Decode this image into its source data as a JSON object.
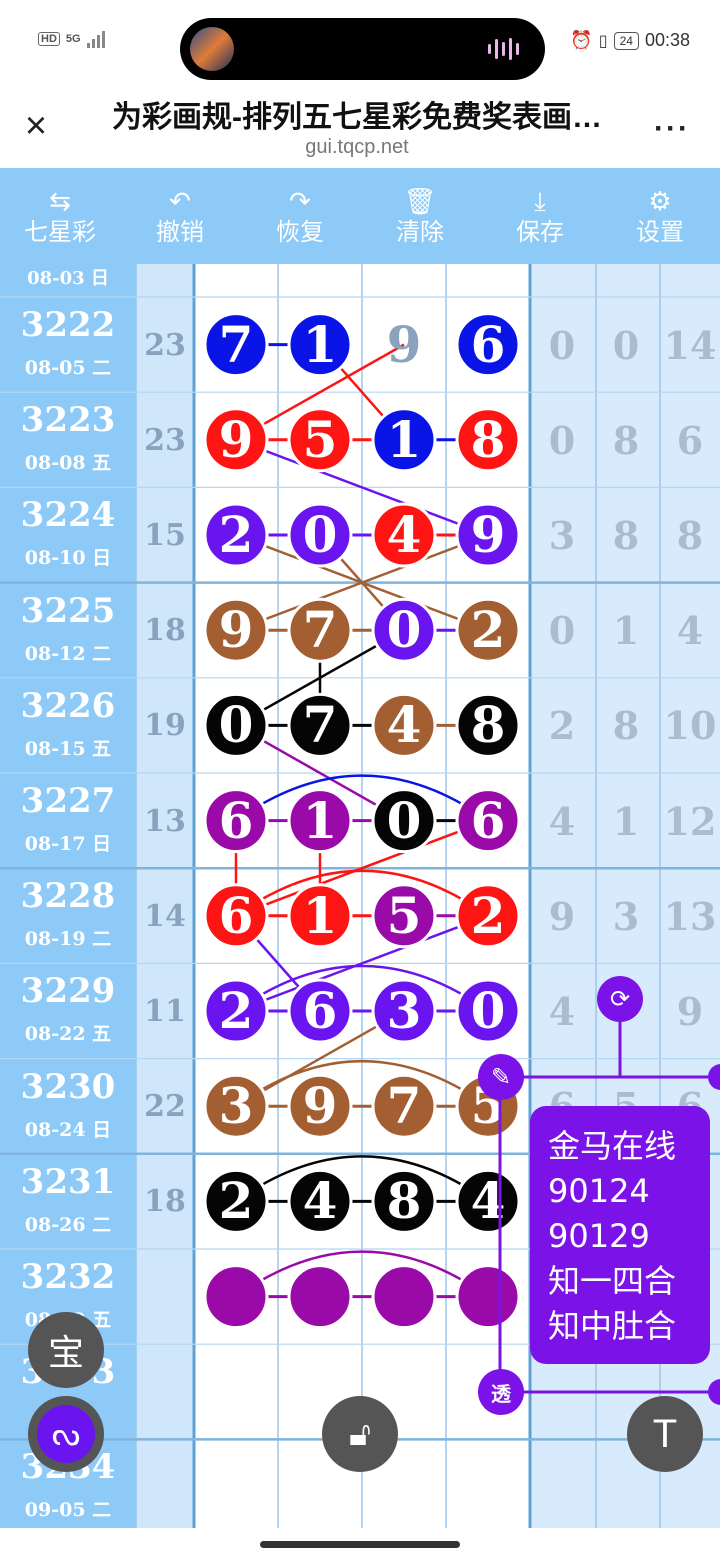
{
  "status": {
    "hd": "HD",
    "net": "5G",
    "battery": "24",
    "time": "00:38"
  },
  "title": {
    "text": "为彩画规-排列五七星彩免费奖表画…",
    "url": "gui.tqcp.net"
  },
  "toolbar": [
    {
      "icon": "swap-icon",
      "glyph": "⇆",
      "label": "七星彩"
    },
    {
      "icon": "undo-icon",
      "glyph": "↶",
      "label": "撤销"
    },
    {
      "icon": "redo-icon",
      "glyph": "↷",
      "label": "恢复"
    },
    {
      "icon": "trash-icon",
      "glyph": "🗑",
      "label": "清除"
    },
    {
      "icon": "download-icon",
      "glyph": "⤓",
      "label": "保存"
    },
    {
      "icon": "gear-icon",
      "glyph": "⚙",
      "label": "设置"
    }
  ],
  "partial_row": {
    "date": "08-03 日"
  },
  "rows": [
    {
      "issue": "3222",
      "date": "08-05 二",
      "sum": "23",
      "digits": [
        "7",
        "1",
        "9",
        "6"
      ],
      "circled": [
        true,
        true,
        false,
        true
      ],
      "color": "#0a14e6",
      "right": [
        "0",
        "0",
        "14"
      ]
    },
    {
      "issue": "3223",
      "date": "08-08 五",
      "sum": "23",
      "digits": [
        "9",
        "5",
        "1",
        "8"
      ],
      "circled": [
        true,
        true,
        true,
        true
      ],
      "colors": [
        "#ff1414",
        "#ff1414",
        "#0a14e6",
        "#ff1414"
      ],
      "right": [
        "0",
        "8",
        "6"
      ]
    },
    {
      "issue": "3224",
      "date": "08-10 日",
      "sum": "15",
      "digits": [
        "2",
        "0",
        "4",
        "9"
      ],
      "circled": [
        true,
        true,
        true,
        true
      ],
      "colors": [
        "#6a14f0",
        "#6a14f0",
        "#ff1414",
        "#6a14f0"
      ],
      "right": [
        "3",
        "8",
        "8"
      ]
    },
    {
      "issue": "3225",
      "date": "08-12 二",
      "sum": "18",
      "digits": [
        "9",
        "7",
        "0",
        "2"
      ],
      "circled": [
        true,
        true,
        true,
        true
      ],
      "colors": [
        "#a35f32",
        "#a35f32",
        "#6a14f0",
        "#a35f32"
      ],
      "right": [
        "0",
        "1",
        "4"
      ]
    },
    {
      "issue": "3226",
      "date": "08-15 五",
      "sum": "19",
      "digits": [
        "0",
        "7",
        "4",
        "8"
      ],
      "circled": [
        true,
        true,
        true,
        true
      ],
      "colors": [
        "#050505",
        "#050505",
        "#a35f32",
        "#050505"
      ],
      "right": [
        "2",
        "8",
        "10"
      ]
    },
    {
      "issue": "3227",
      "date": "08-17 日",
      "sum": "13",
      "digits": [
        "6",
        "1",
        "0",
        "6"
      ],
      "circled": [
        true,
        true,
        true,
        true
      ],
      "colors": [
        "#9a0aa8",
        "#9a0aa8",
        "#050505",
        "#9a0aa8"
      ],
      "right": [
        "4",
        "1",
        "12"
      ]
    },
    {
      "issue": "3228",
      "date": "08-19 二",
      "sum": "14",
      "digits": [
        "6",
        "1",
        "5",
        "2"
      ],
      "circled": [
        true,
        true,
        true,
        true
      ],
      "colors": [
        "#ff1414",
        "#ff1414",
        "#9a0aa8",
        "#ff1414"
      ],
      "right": [
        "9",
        "3",
        "13"
      ]
    },
    {
      "issue": "3229",
      "date": "08-22 五",
      "sum": "11",
      "digits": [
        "2",
        "6",
        "3",
        "0"
      ],
      "circled": [
        true,
        true,
        true,
        true
      ],
      "colors": [
        "#6a14f0",
        "#6a14f0",
        "#6a14f0",
        "#6a14f0"
      ],
      "right": [
        "4",
        "",
        "9"
      ]
    },
    {
      "issue": "3230",
      "date": "08-24 日",
      "sum": "22",
      "digits": [
        "3",
        "9",
        "7",
        "5"
      ],
      "circled": [
        true,
        true,
        true,
        true
      ],
      "colors": [
        "#a35f32",
        "#a35f32",
        "#a35f32",
        "#a35f32"
      ],
      "right": [
        "6",
        "5",
        "6"
      ]
    },
    {
      "issue": "3231",
      "date": "08-26 二",
      "sum": "18",
      "digits": [
        "2",
        "4",
        "8",
        "4"
      ],
      "circled": [
        true,
        true,
        true,
        true
      ],
      "colors": [
        "#050505",
        "#050505",
        "#050505",
        "#050505"
      ],
      "right": [
        "",
        "",
        ""
      ]
    },
    {
      "issue": "3232",
      "date": "08-29 五",
      "sum": "",
      "digits": [
        "",
        "",
        "",
        ""
      ],
      "circled": [
        true,
        true,
        true,
        true
      ],
      "colors": [
        "#9a0aa8",
        "#9a0aa8",
        "#9a0aa8",
        "#9a0aa8"
      ],
      "right": [
        "",
        "",
        ""
      ]
    },
    {
      "issue": "3233",
      "date": "",
      "sum": "",
      "digits": [
        "",
        "",
        "",
        ""
      ],
      "circled": [
        false,
        false,
        false,
        false
      ],
      "right": [
        "",
        "",
        ""
      ]
    },
    {
      "issue": "3234",
      "date": "09-05 二",
      "sum": "",
      "digits": [
        "",
        "",
        "",
        ""
      ],
      "circled": [
        false,
        false,
        false,
        false
      ],
      "right": [
        "",
        "",
        ""
      ]
    }
  ],
  "note": {
    "lines": [
      "金马在线",
      "90124",
      "90129",
      "知一四合",
      "知中肚合"
    ]
  },
  "buttons": {
    "bao": "宝",
    "tou": "透",
    "top": "T"
  }
}
